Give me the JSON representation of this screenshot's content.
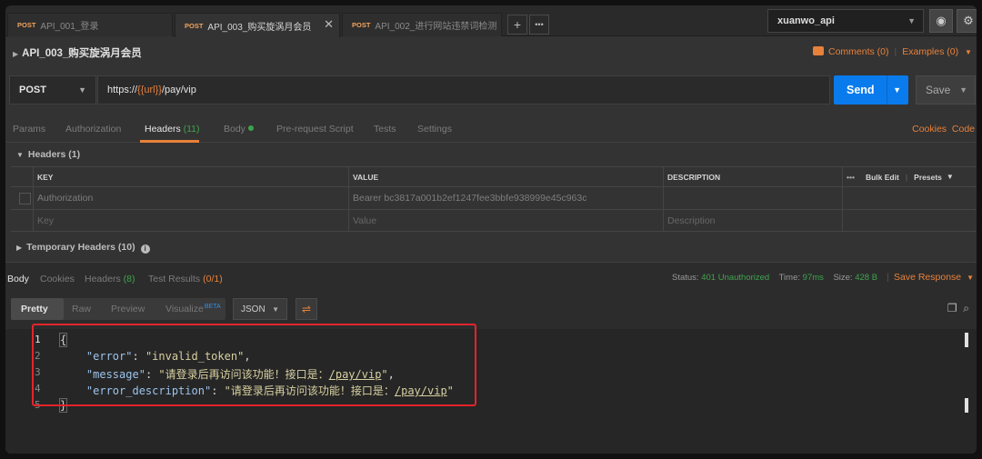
{
  "tabs": [
    {
      "method": "POST",
      "name": "API_001_登录"
    },
    {
      "method": "POST",
      "name": "API_003_购买旋涡月会员",
      "active": true
    },
    {
      "method": "POST",
      "name": "API_002_进行网站违禁词检测"
    }
  ],
  "tab_close": "✕",
  "new_tab": "+",
  "more_tabs": "•••",
  "environment": "xuanwo_api",
  "eye_icon": "eye-icon",
  "gear_icon": "gear-icon",
  "request": {
    "title": "API_003_购买旋涡月会员",
    "method": "POST",
    "url_prefix": "https://",
    "url_var": "{{url}}",
    "url_suffix": "/pay/vip",
    "send": "Send",
    "save": "Save"
  },
  "comments": "Comments (0)",
  "examples": "Examples (0)",
  "request_tabs": {
    "params": "Params",
    "authorization": "Authorization",
    "headers": "Headers",
    "headers_count": "(11)",
    "body": "Body",
    "pre_request": "Pre-request Script",
    "tests": "Tests",
    "settings": "Settings",
    "cookies": "Cookies",
    "code": "Code"
  },
  "headers_section": "Headers (1)",
  "headers_table": {
    "columns": [
      "KEY",
      "VALUE",
      "DESCRIPTION"
    ],
    "row": {
      "key": "Authorization",
      "value": "Bearer bc3817a001b2ef1247fee3bbfe938999e45c963c",
      "description": ""
    },
    "placeholder": {
      "key": "Key",
      "value": "Value",
      "description": "Description"
    },
    "bulk_edit": "Bulk Edit",
    "presets": "Presets",
    "more": "•••"
  },
  "temporary_headers": "Temporary Headers (10)",
  "response_tabs": {
    "body": "Body",
    "cookies": "Cookies",
    "headers": "Headers",
    "headers_count": "(8)",
    "test_results": "Test Results",
    "test_count": "(0/1)"
  },
  "status": {
    "status_label": "Status:",
    "status_value": "401 Unauthorized",
    "time_label": "Time:",
    "time_value": "97ms",
    "size_label": "Size:",
    "size_value": "428 B",
    "save_response": "Save Response"
  },
  "view_modes": {
    "pretty": "Pretty",
    "raw": "Raw",
    "preview": "Preview",
    "visualize": "Visualize",
    "beta": "BETA"
  },
  "format": "JSON",
  "code_lines": [
    {
      "n": "1",
      "open": "{"
    },
    {
      "n": "2",
      "key": "\"error\"",
      "value": "\"invalid_token\"",
      "tail": ","
    },
    {
      "n": "3",
      "key": "\"message\"",
      "value_pre": "\"请登录后再访问该功能！接口是：",
      "value_link": "/pay/vip",
      "value_post": "\"",
      "tail": ","
    },
    {
      "n": "4",
      "key": "\"error_description\"",
      "value_pre": "\"请登录后再访问该功能！接口是：",
      "value_link": "/pay/vip",
      "value_post": "\"",
      "tail": ""
    },
    {
      "n": "5",
      "close": "}"
    }
  ],
  "colors": {
    "accent": "#e8813a",
    "send": "#097bed",
    "success": "#3fa34d",
    "highlight_box": "#e4242a"
  }
}
